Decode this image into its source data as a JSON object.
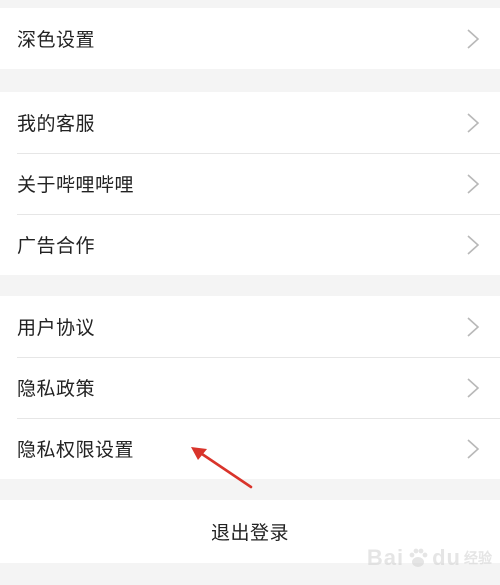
{
  "groups": [
    {
      "items": [
        {
          "label": "深色设置"
        }
      ]
    },
    {
      "items": [
        {
          "label": "我的客服"
        },
        {
          "label": "关于哔哩哔哩"
        },
        {
          "label": "广告合作"
        }
      ]
    },
    {
      "items": [
        {
          "label": "用户协议"
        },
        {
          "label": "隐私政策"
        },
        {
          "label": "隐私权限设置"
        }
      ]
    }
  ],
  "logout": {
    "label": "退出登录"
  },
  "watermark": {
    "text": "Bai",
    "text2": "du",
    "sub": "经验"
  },
  "colors": {
    "background": "#f4f4f4",
    "row": "#ffffff",
    "text": "#222222",
    "chevron": "#b8b8b8",
    "annotation_arrow": "#d9342b"
  }
}
